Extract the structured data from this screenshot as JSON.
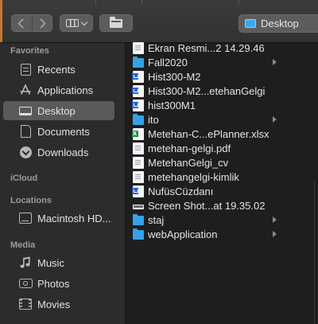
{
  "toolbar": {
    "location_label": "Desktop",
    "back_icon": "chevron-left-icon",
    "forward_icon": "chevron-right-icon",
    "view_icon": "column-view-icon",
    "group_icon": "folder-icon"
  },
  "sidebar": {
    "favorites_heading": "Favorites",
    "favorites": [
      {
        "label": "Recents",
        "icon": "recents-icon"
      },
      {
        "label": "Applications",
        "icon": "applications-icon"
      },
      {
        "label": "Desktop",
        "icon": "desktop-icon",
        "selected": true
      },
      {
        "label": "Documents",
        "icon": "documents-icon"
      },
      {
        "label": "Downloads",
        "icon": "downloads-icon"
      }
    ],
    "icloud_heading": "iCloud",
    "locations_heading": "Locations",
    "locations": [
      {
        "label": "Macintosh HD...",
        "icon": "hard-drive-icon"
      }
    ],
    "media_heading": "Media",
    "media": [
      {
        "label": "Music",
        "icon": "music-icon"
      },
      {
        "label": "Photos",
        "icon": "photos-icon"
      },
      {
        "label": "Movies",
        "icon": "movies-icon"
      }
    ]
  },
  "files": [
    {
      "name": "Ekran Resmi...2 14.29.46",
      "kind": "document",
      "folder": false
    },
    {
      "name": "Fall2020",
      "kind": "folder",
      "folder": true
    },
    {
      "name": "Hist300-M2",
      "kind": "word",
      "folder": false
    },
    {
      "name": "Hist300-M2...etehanGelgi",
      "kind": "word",
      "folder": false
    },
    {
      "name": "hist300M1",
      "kind": "word",
      "folder": false
    },
    {
      "name": "ito",
      "kind": "folder",
      "folder": true
    },
    {
      "name": "Metehan-C...ePlanner.xlsx",
      "kind": "excel",
      "folder": false
    },
    {
      "name": "metehan-gelgi.pdf",
      "kind": "pdf",
      "folder": false
    },
    {
      "name": "MetehanGelgi_cv",
      "kind": "document",
      "folder": false
    },
    {
      "name": "metehangelgi-kimlik",
      "kind": "document",
      "folder": false
    },
    {
      "name": "NufüsCüzdanı",
      "kind": "word",
      "folder": false
    },
    {
      "name": "Screen Shot...at 19.35.02",
      "kind": "image",
      "folder": false
    },
    {
      "name": "staj",
      "kind": "folder",
      "folder": true
    },
    {
      "name": "webApplication",
      "kind": "folder",
      "folder": true
    }
  ],
  "colors": {
    "accent_folder": "#36a2e6",
    "selection": "#5a5a5a",
    "sidebar_bg": "#2c2c2c",
    "content_bg": "#1e1e1e"
  }
}
